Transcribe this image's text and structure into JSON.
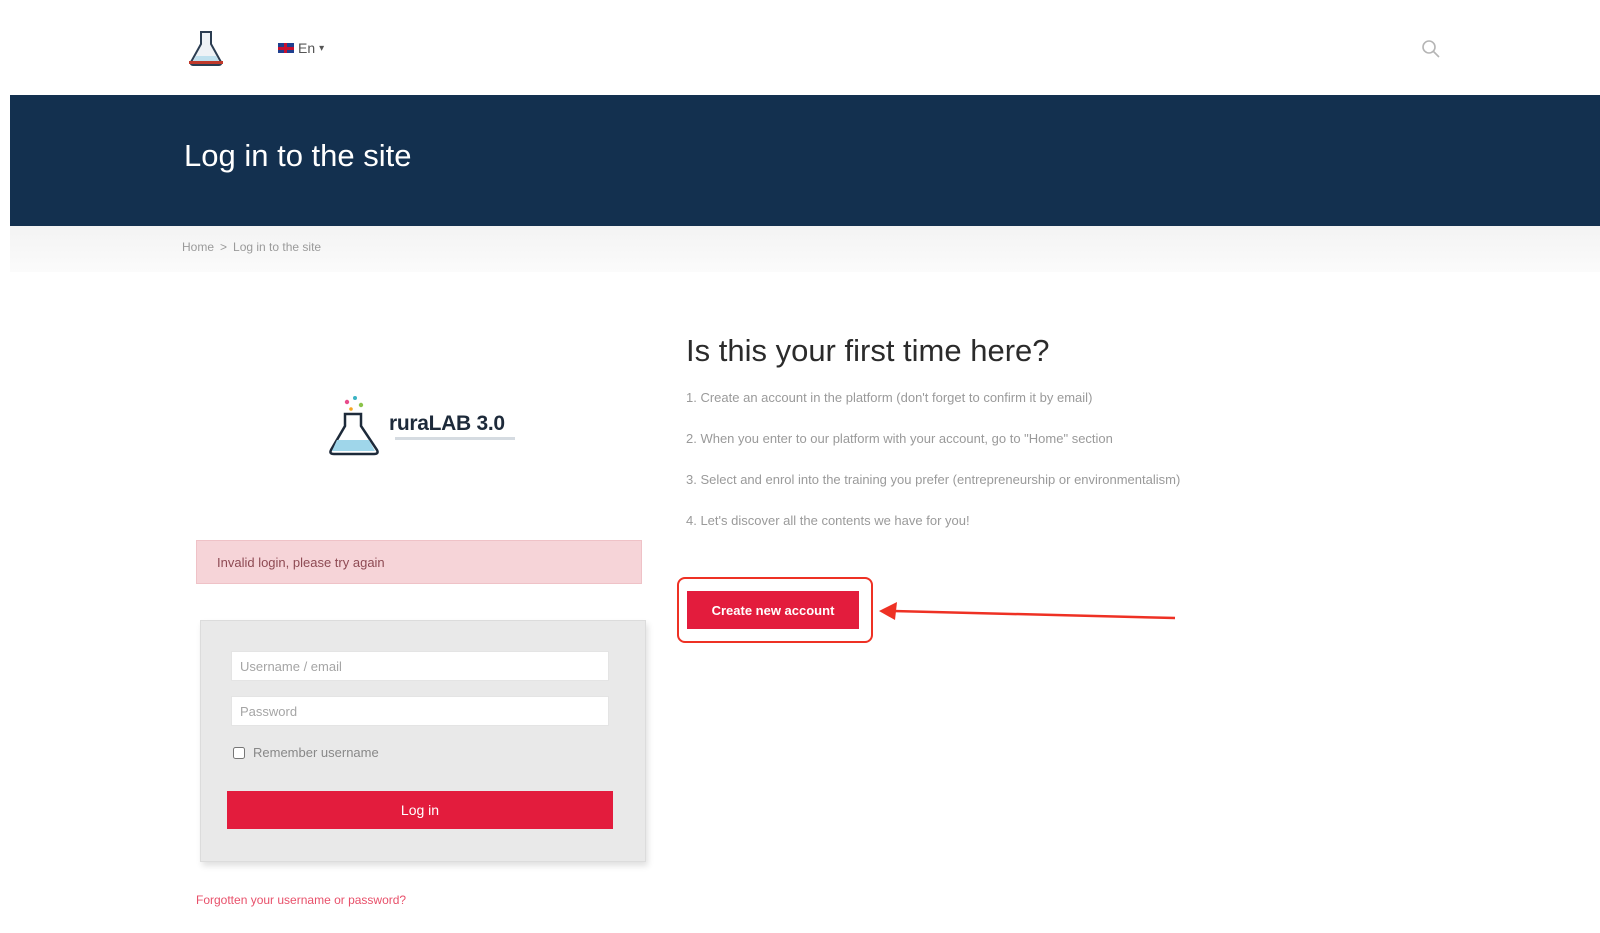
{
  "topnav": {
    "language": {
      "label": "En",
      "flag_icon": "uk-flag-icon"
    },
    "logo_icon": "flask-logo-icon",
    "search_icon": "search-icon"
  },
  "header": {
    "title": "Log in to the site"
  },
  "breadcrumb": {
    "items": [
      "Home",
      "Log in to the site"
    ],
    "separator": ">"
  },
  "brand": {
    "name": "ruraLAB 3.0"
  },
  "login": {
    "error": "Invalid login, please try again",
    "username_placeholder": "Username / email",
    "password_placeholder": "Password",
    "remember_label": "Remember username",
    "submit_label": "Log in",
    "forgot_link": "Forgotten your username or password?"
  },
  "first_time": {
    "title": "Is this your first time here?",
    "steps": [
      "1. Create an account in the platform (don't forget to confirm it by email)",
      "2. When you enter to our platform with your account, go to \"Home\" section",
      "3. Select and enrol into the training you prefer (entrepreneurship or environmentalism)",
      "4. Let's discover all the contents we have for you!"
    ],
    "create_account_label": "Create new account"
  },
  "colors": {
    "banner": "#13304f",
    "accent_red": "#e31c3d",
    "highlight_border": "#ee3124",
    "alert_bg": "#f6d4d8"
  }
}
